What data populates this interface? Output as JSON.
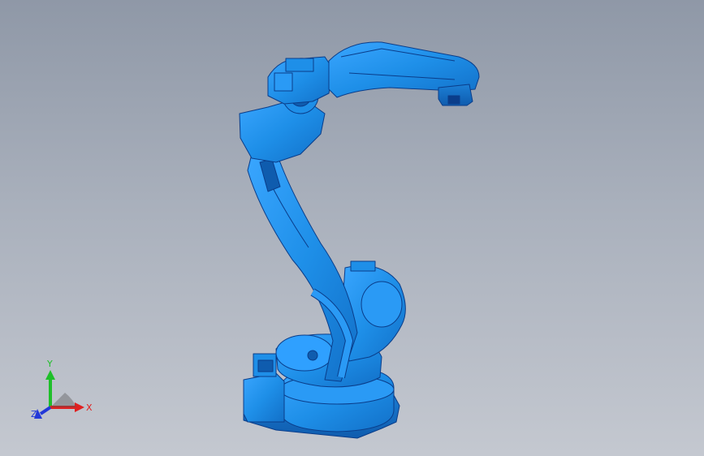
{
  "viewport": {
    "background_top": "#8f98a7",
    "background_bottom": "#c4c8d0",
    "model_color": "#1e8fe8",
    "model_edge_color": "#0a3d8a"
  },
  "triad": {
    "x_label": "X",
    "y_label": "Y",
    "z_label": "Z",
    "x_color": "#e02020",
    "y_color": "#1fbf2a",
    "z_color": "#2338d8"
  }
}
